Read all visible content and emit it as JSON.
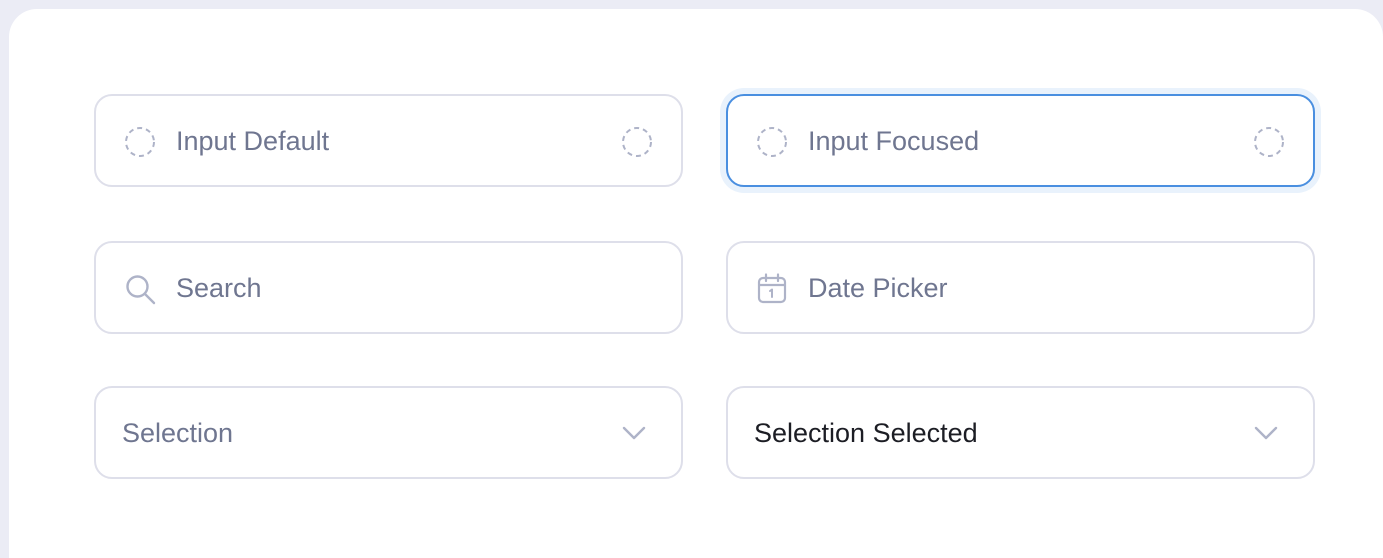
{
  "inputs": {
    "default_placeholder": "Input Default",
    "focused_placeholder": "Input Focused",
    "search_placeholder": "Search",
    "date_placeholder": "Date Picker"
  },
  "selects": {
    "empty_label": "Selection",
    "selected_value": "Selection Selected"
  },
  "icons": {
    "leading_placeholder": "dashed-circle-icon",
    "trailing_placeholder": "dashed-circle-icon",
    "search": "search-icon",
    "date": "calendar-icon",
    "dropdown": "chevron-down-icon"
  },
  "colors": {
    "page_background": "#ebecf5",
    "card_background": "#ffffff",
    "field_border": "#dedfea",
    "focus_border": "#4a8fe0",
    "focus_ring": "#e9f2fc",
    "placeholder_text": "#6f7690",
    "value_text": "#1c1d24",
    "icon": "#aeb3c8"
  }
}
